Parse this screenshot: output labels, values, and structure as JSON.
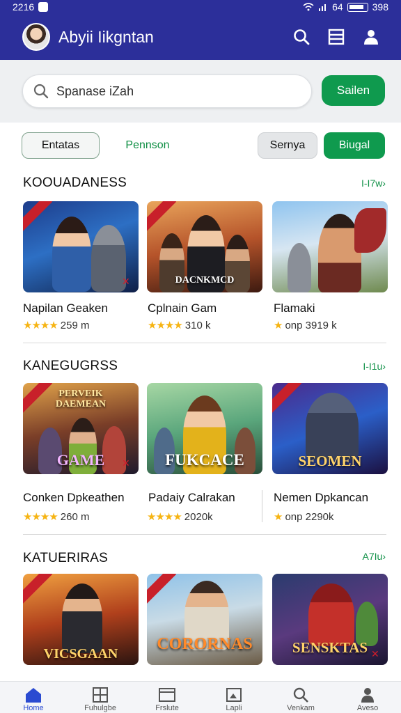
{
  "status_bar": {
    "time": "2216",
    "right_text": "64",
    "battery": "398"
  },
  "app_bar": {
    "title": "Abyii Iikgntan"
  },
  "search": {
    "placeholder": "Spanase iZah",
    "button_label": "Sailen"
  },
  "chips": [
    {
      "label": "Entatas"
    },
    {
      "label": "Pennson"
    },
    {
      "label": "Sernya"
    },
    {
      "label": "Biugal"
    }
  ],
  "sections": [
    {
      "title": "KOOUADANESS",
      "more": "I-I7w›",
      "games": [
        {
          "title": "Napilan Geaken",
          "stars": "★★★★",
          "meta": "259 m",
          "overlay": ""
        },
        {
          "title": "Cplnain Gam",
          "stars": "★★★★",
          "meta": "310 k",
          "overlay": "DACNKMCD"
        },
        {
          "title": "Flamaki",
          "stars": "★",
          "meta": "onp 3919 k",
          "overlay": ""
        }
      ]
    },
    {
      "title": "KANEGUGRSS",
      "more": "I-I1u›",
      "games": [
        {
          "title": "Conken Dpkeathen",
          "stars": "★★★★",
          "meta": "260 m",
          "overlay": "GAME",
          "overlay_top": "PERVEIK DAEMEAN"
        },
        {
          "title": "Padaiy Calrakan",
          "stars": "★★★★",
          "meta": "2020k",
          "overlay": "FUKCACE"
        },
        {
          "title": "Nemen Dpkancan",
          "stars": "★",
          "meta": "onp 2290k",
          "overlay": "SEOMEN"
        }
      ]
    },
    {
      "title": "KATUERIRAS",
      "more": "A7Iu›",
      "games": [
        {
          "title": "",
          "stars": "",
          "meta": "",
          "overlay": "VICSGAAN"
        },
        {
          "title": "",
          "stars": "",
          "meta": "",
          "overlay": "CORORNAS"
        },
        {
          "title": "",
          "stars": "",
          "meta": "",
          "overlay": "SENSKTAS"
        }
      ]
    }
  ],
  "bottom_nav": [
    {
      "label": "Home",
      "icon": "home-icon"
    },
    {
      "label": "Fuhulgbe",
      "icon": "grid-icon"
    },
    {
      "label": "Frslute",
      "icon": "window-icon"
    },
    {
      "label": "Lapli",
      "icon": "image-icon"
    },
    {
      "label": "Venkam",
      "icon": "search-icon"
    },
    {
      "label": "Aveso",
      "icon": "person-icon"
    }
  ],
  "colors": {
    "primary": "#2c2f9a",
    "accent": "#0f9a4e",
    "star": "#f6b413"
  }
}
